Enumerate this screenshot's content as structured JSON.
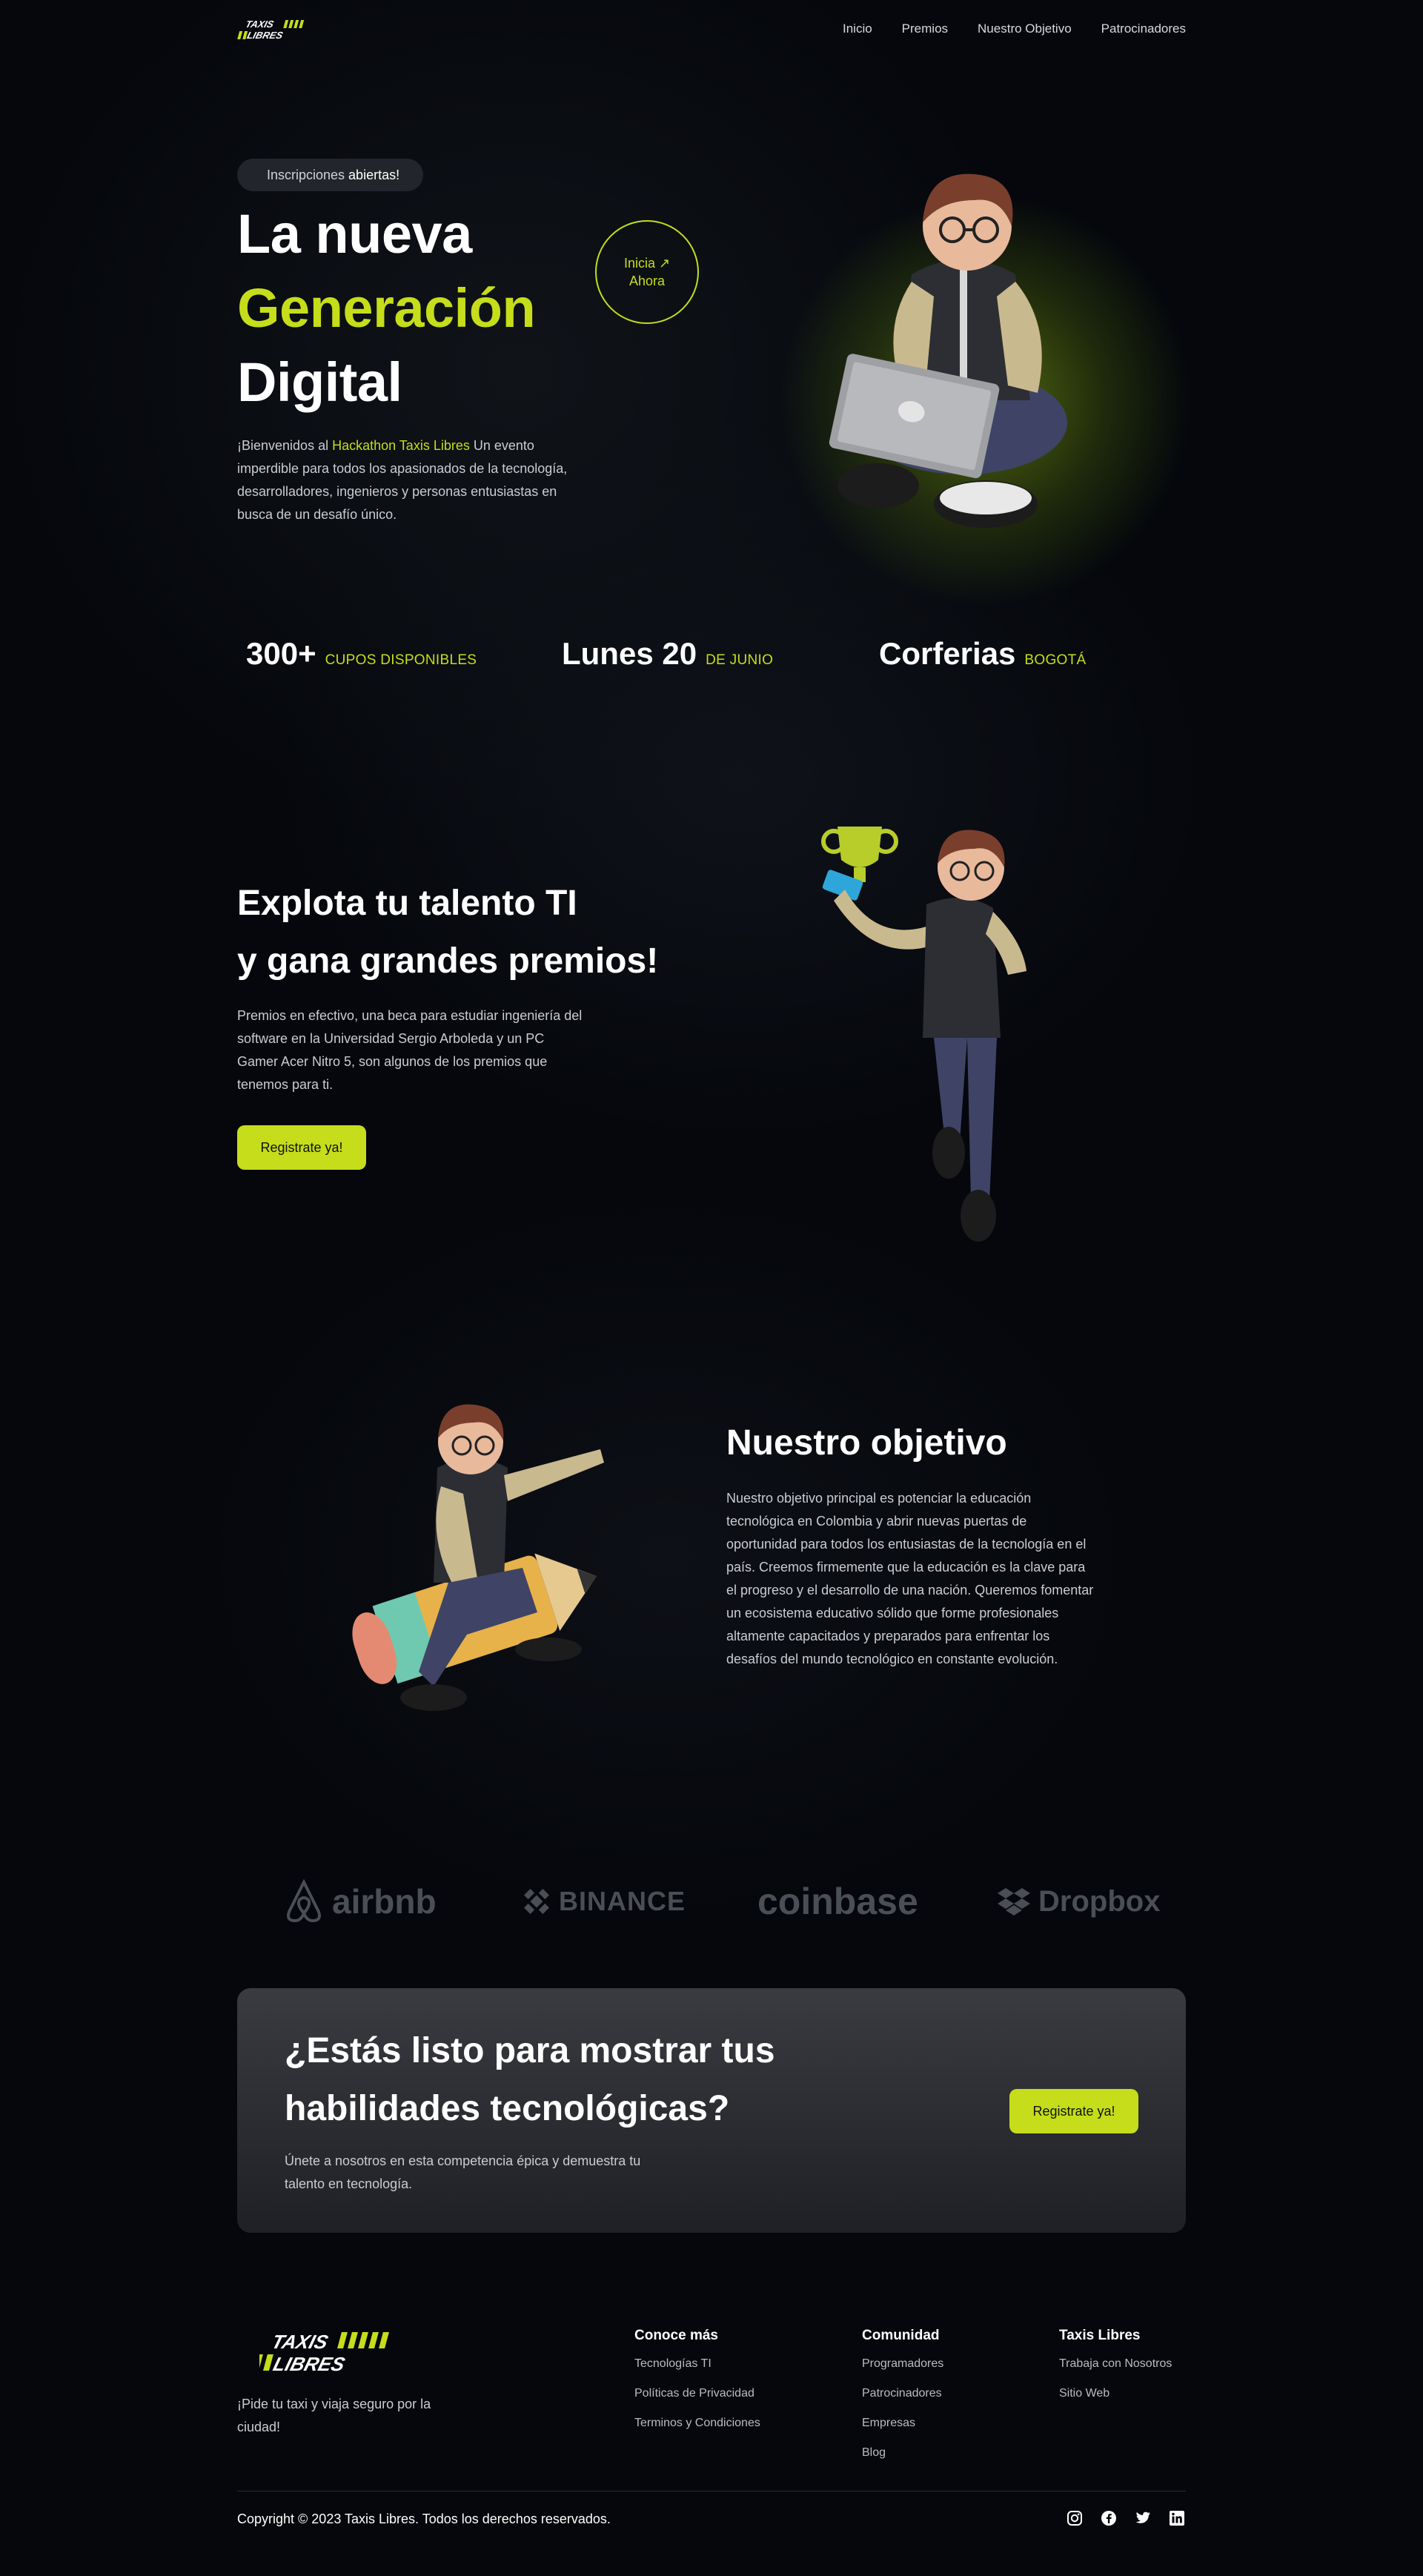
{
  "brand": {
    "logo_line1": "TAXIS",
    "logo_line2": "LIBRES",
    "accent": "#c5dd1a"
  },
  "nav": {
    "items": [
      "Inicio",
      "Premios",
      "Nuestro Objetivo",
      "Patrocinadores"
    ]
  },
  "hero": {
    "pill_prefix": "Inscripciones",
    "pill_strong": "abiertas!",
    "title_line1": "La nueva",
    "title_line2": "Generación",
    "title_line3": "Digital",
    "cta_line1": "Inicia ↗",
    "cta_line2": "Ahora",
    "desc_prefix": "¡Bienvenidos al ",
    "desc_highlight": "Hackathon Taxis Libres",
    "desc_suffix": " Un evento imperdible para todos los apasionados de la tecnología, desarrolladores, ingenieros y personas entusiastas en busca de un desafío único."
  },
  "stats": [
    {
      "big": "300+",
      "small": "CUPOS DISPONIBLES"
    },
    {
      "big": "Lunes 20",
      "small": "DE JUNIO"
    },
    {
      "big": "Corferias",
      "small": "BOGOTÁ"
    }
  ],
  "prizes": {
    "title_line1": "Explota tu talento TI",
    "title_line2": "y gana grandes premios!",
    "desc": "Premios en efectivo, una beca para estudiar ingeniería del software en la Universidad Sergio Arboleda y un PC Gamer Acer Nitro 5, son algunos de los premios que tenemos para ti.",
    "button": "Registrate ya!"
  },
  "objective": {
    "title": "Nuestro objetivo",
    "desc": "Nuestro objetivo principal es potenciar la educación tecnológica en Colombia y abrir nuevas puertas de oportunidad para todos los entusiastas de la tecnología en el país. Creemos firmemente que la educación es la clave para el progreso y el desarrollo de una nación. Queremos fomentar un ecosistema educativo sólido que forme profesionales altamente capacitados y preparados para enfrentar los desafíos del mundo tecnológico en constante evolución."
  },
  "sponsors": [
    "airbnb",
    "BINANCE",
    "coinbase",
    "Dropbox"
  ],
  "cta": {
    "title_line1": "¿Estás listo para mostrar tus",
    "title_line2": "habilidades tecnológicas?",
    "desc": "Únete a nosotros en esta competencia épica y demuestra tu talento en tecnología.",
    "button": "Registrate ya!"
  },
  "footer": {
    "tagline": "¡Pide tu taxi y viaja seguro por la ciudad!",
    "columns": [
      {
        "title": "Conoce más",
        "links": [
          "Tecnologías TI",
          "Políticas de Privacidad",
          "Terminos y Condiciones"
        ]
      },
      {
        "title": "Comunidad",
        "links": [
          "Programadores",
          "Patrocinadores",
          "Empresas",
          "Blog"
        ]
      },
      {
        "title": "Taxis Libres",
        "links": [
          "Trabaja con Nosotros",
          "Sitio Web"
        ]
      }
    ],
    "copyright": "Copyright © 2023 Taxis Libres. Todos los derechos reservados.",
    "socials": [
      "instagram-icon",
      "facebook-icon",
      "twitter-icon",
      "linkedin-icon"
    ]
  }
}
